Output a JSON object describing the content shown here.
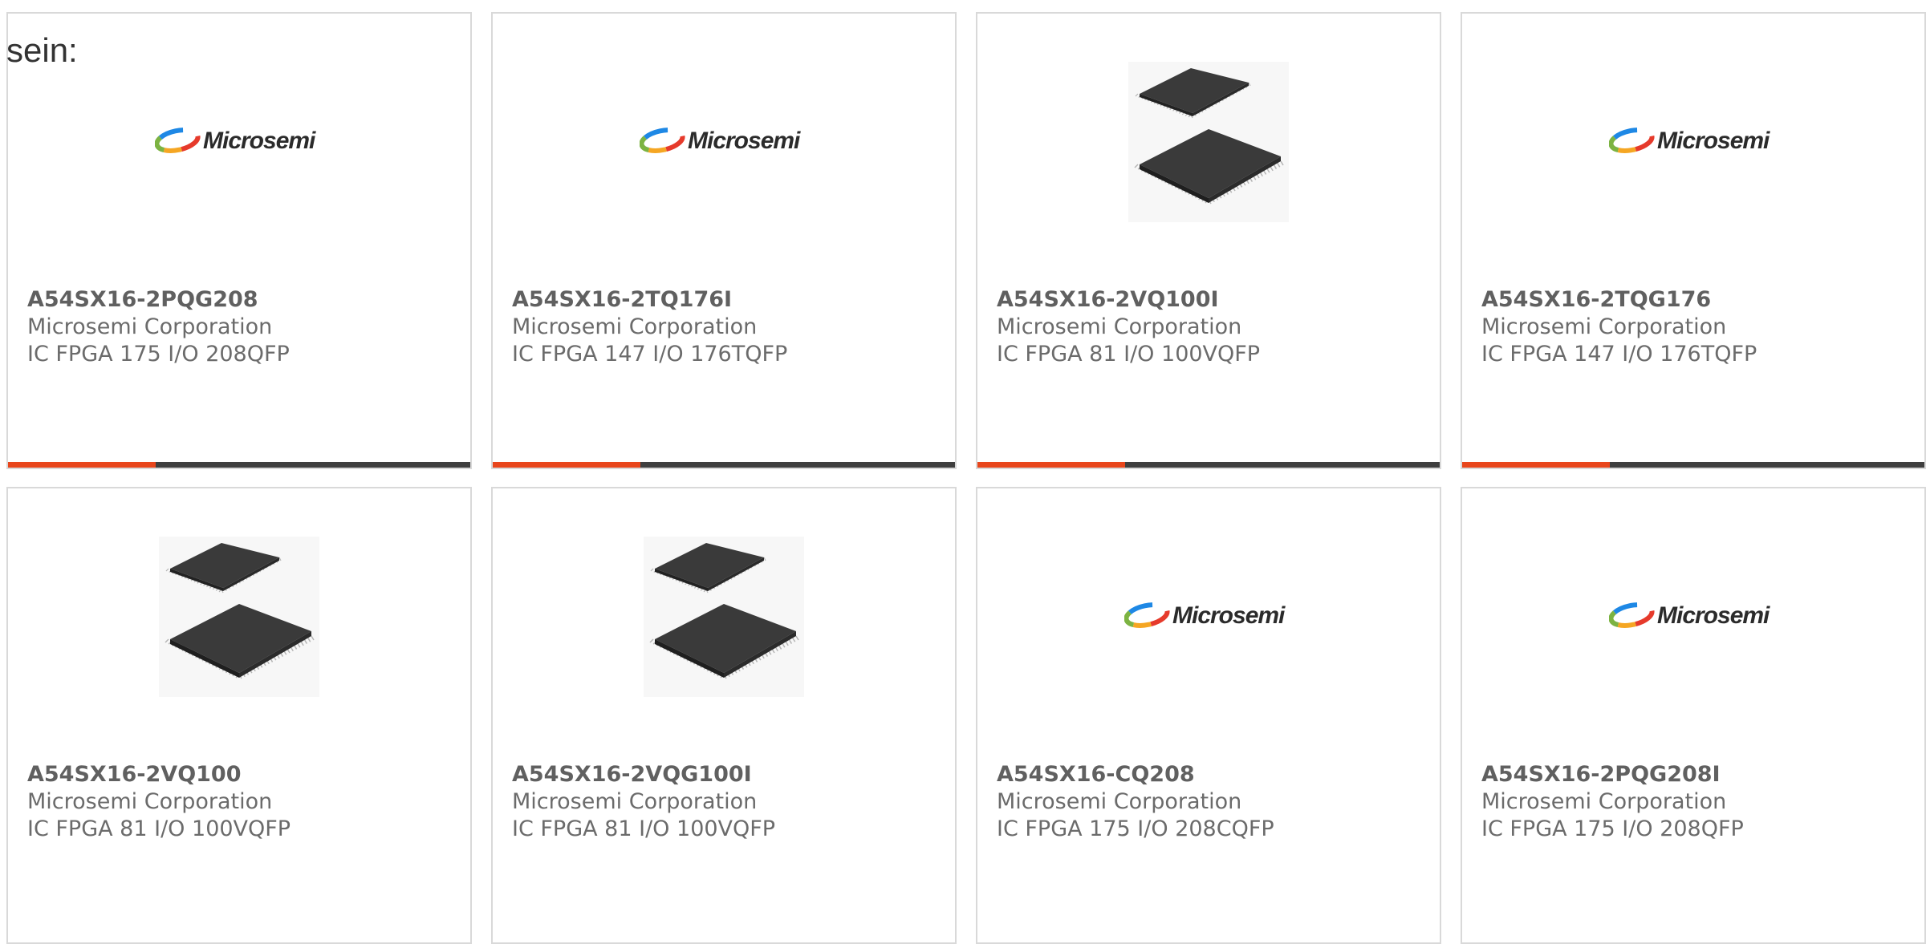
{
  "heading": "sein:",
  "colors": {
    "accent": "#e8461c",
    "bar_track": "#3f3f3f",
    "card_border": "#d9d9d9",
    "text": "#6b6b6b"
  },
  "cards": [
    {
      "part": "A54SX16-2PQG208",
      "maker": "Microsemi Corporation",
      "desc": "IC FPGA 175 I/O 208QFP",
      "image": "microsemi-logo",
      "logo_text": "Microsemi",
      "progress": 0.32
    },
    {
      "part": "A54SX16-2TQ176I",
      "maker": "Microsemi Corporation",
      "desc": "IC FPGA 147 I/O 176TQFP",
      "image": "microsemi-logo",
      "logo_text": "Microsemi",
      "progress": 0.32
    },
    {
      "part": "A54SX16-2VQ100I",
      "maker": "Microsemi Corporation",
      "desc": "IC FPGA 81 I/O 100VQFP",
      "image": "chip-package",
      "progress": 0.32
    },
    {
      "part": "A54SX16-2TQG176",
      "maker": "Microsemi Corporation",
      "desc": "IC FPGA 147 I/O 176TQFP",
      "image": "microsemi-logo",
      "logo_text": "Microsemi",
      "progress": 0.32
    },
    {
      "part": "A54SX16-2VQ100",
      "maker": "Microsemi Corporation",
      "desc": "IC FPGA 81 I/O 100VQFP",
      "image": "chip-package",
      "progress": null
    },
    {
      "part": "A54SX16-2VQG100I",
      "maker": "Microsemi Corporation",
      "desc": "IC FPGA 81 I/O 100VQFP",
      "image": "chip-package",
      "progress": null
    },
    {
      "part": "A54SX16-CQ208",
      "maker": "Microsemi Corporation",
      "desc": "IC FPGA 175 I/O 208CQFP",
      "image": "microsemi-logo",
      "logo_text": "Microsemi",
      "progress": null
    },
    {
      "part": "A54SX16-2PQG208I",
      "maker": "Microsemi Corporation",
      "desc": "IC FPGA 175 I/O 208QFP",
      "image": "microsemi-logo",
      "logo_text": "Microsemi",
      "progress": null
    }
  ]
}
